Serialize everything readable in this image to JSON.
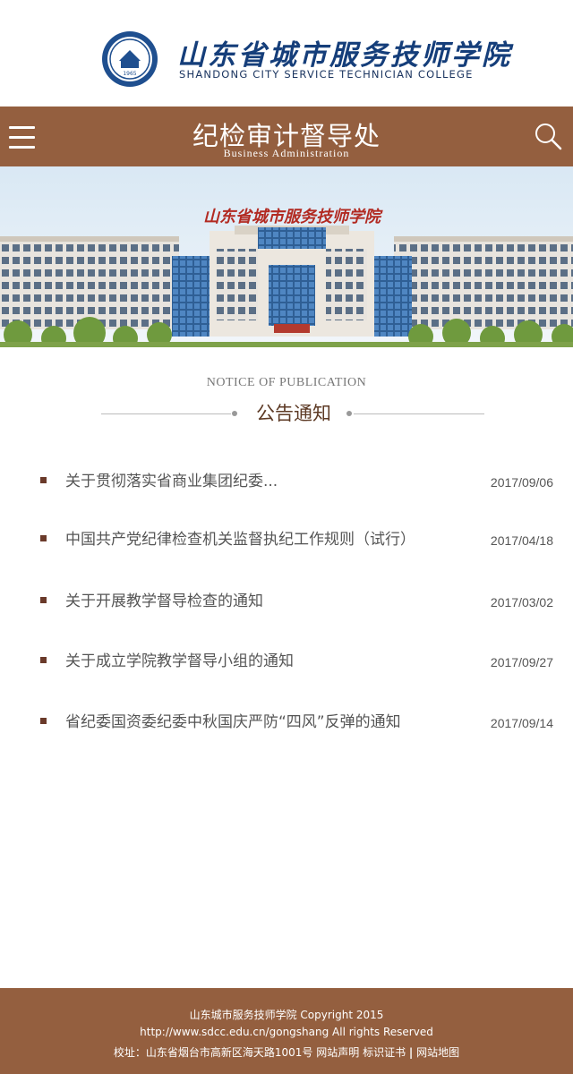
{
  "header": {
    "logo_cn": "山东省城市服务技师学院",
    "logo_en": "SHANDONG CITY SERVICE TECHNICIAN COLLEGE",
    "seal_year": "1965"
  },
  "nav": {
    "title": "纪检审计督导处",
    "subtitle": "Business  Administration",
    "menu_icon": "hamburger-menu-icon",
    "search_icon": "magnifier-search-icon"
  },
  "banner": {
    "building_sign": "山东省城市服务技师学院"
  },
  "section": {
    "title_en": "NOTICE OF PUBLICATION",
    "title_cn": "公告通知"
  },
  "notices": [
    {
      "title": "关于贯彻落实省商业集团纪委...",
      "date": "2017/09/06"
    },
    {
      "title": "中国共产党纪律检查机关监督执纪工作规则（试行）",
      "date": "2017/04/18"
    },
    {
      "title": "关于开展教学督导检查的通知",
      "date": "2017/03/02"
    },
    {
      "title": "关于成立学院教学督导小组的通知",
      "date": "2017/09/27"
    },
    {
      "title": "省纪委国资委纪委中秋国庆严防“四风”反弹的通知",
      "date": "2017/09/14"
    }
  ],
  "footer": {
    "line1": "山东城市服务技师学院 Copyright 2015",
    "line2": "http://www.sdcc.edu.cn/gongshang All rights Reserved",
    "address": "校址：山东省烟台市高新区海天路1001号",
    "link_statement": "网站声明",
    "link_cert": "标识证书",
    "separator": "|",
    "link_sitemap": "网站地图"
  },
  "colors": {
    "brand_brown": "#945f3f",
    "heading_brown": "#5d3a25",
    "logo_blue": "#153e7a"
  }
}
